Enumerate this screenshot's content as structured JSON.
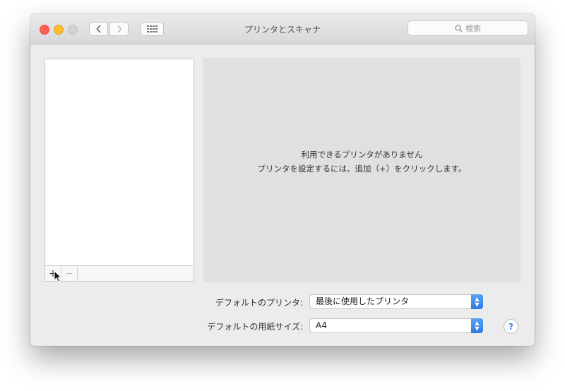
{
  "window": {
    "title": "プリンタとスキャナ"
  },
  "toolbar": {
    "back_icon": "chevron-left-icon",
    "forward_icon": "chevron-right-icon",
    "grid_icon": "grid-icon",
    "search_placeholder": "検索"
  },
  "printer_list": {
    "items": [],
    "add_label": "+",
    "remove_label": "−"
  },
  "detail": {
    "empty_line1": "利用できるプリンタがありません",
    "empty_line2": "プリンタを設定するには、追加（+）をクリックします。"
  },
  "settings": {
    "default_printer_label": "デフォルトのプリンタ:",
    "default_printer_value": "最後に使用したプリンタ",
    "paper_size_label": "デフォルトの用紙サイズ:",
    "paper_size_value": "A4",
    "help_label": "?"
  },
  "colors": {
    "close": "#fd5f57",
    "minimize": "#febc2e",
    "zoom": "#d2d2d2",
    "accent": "#2b7ceb"
  }
}
